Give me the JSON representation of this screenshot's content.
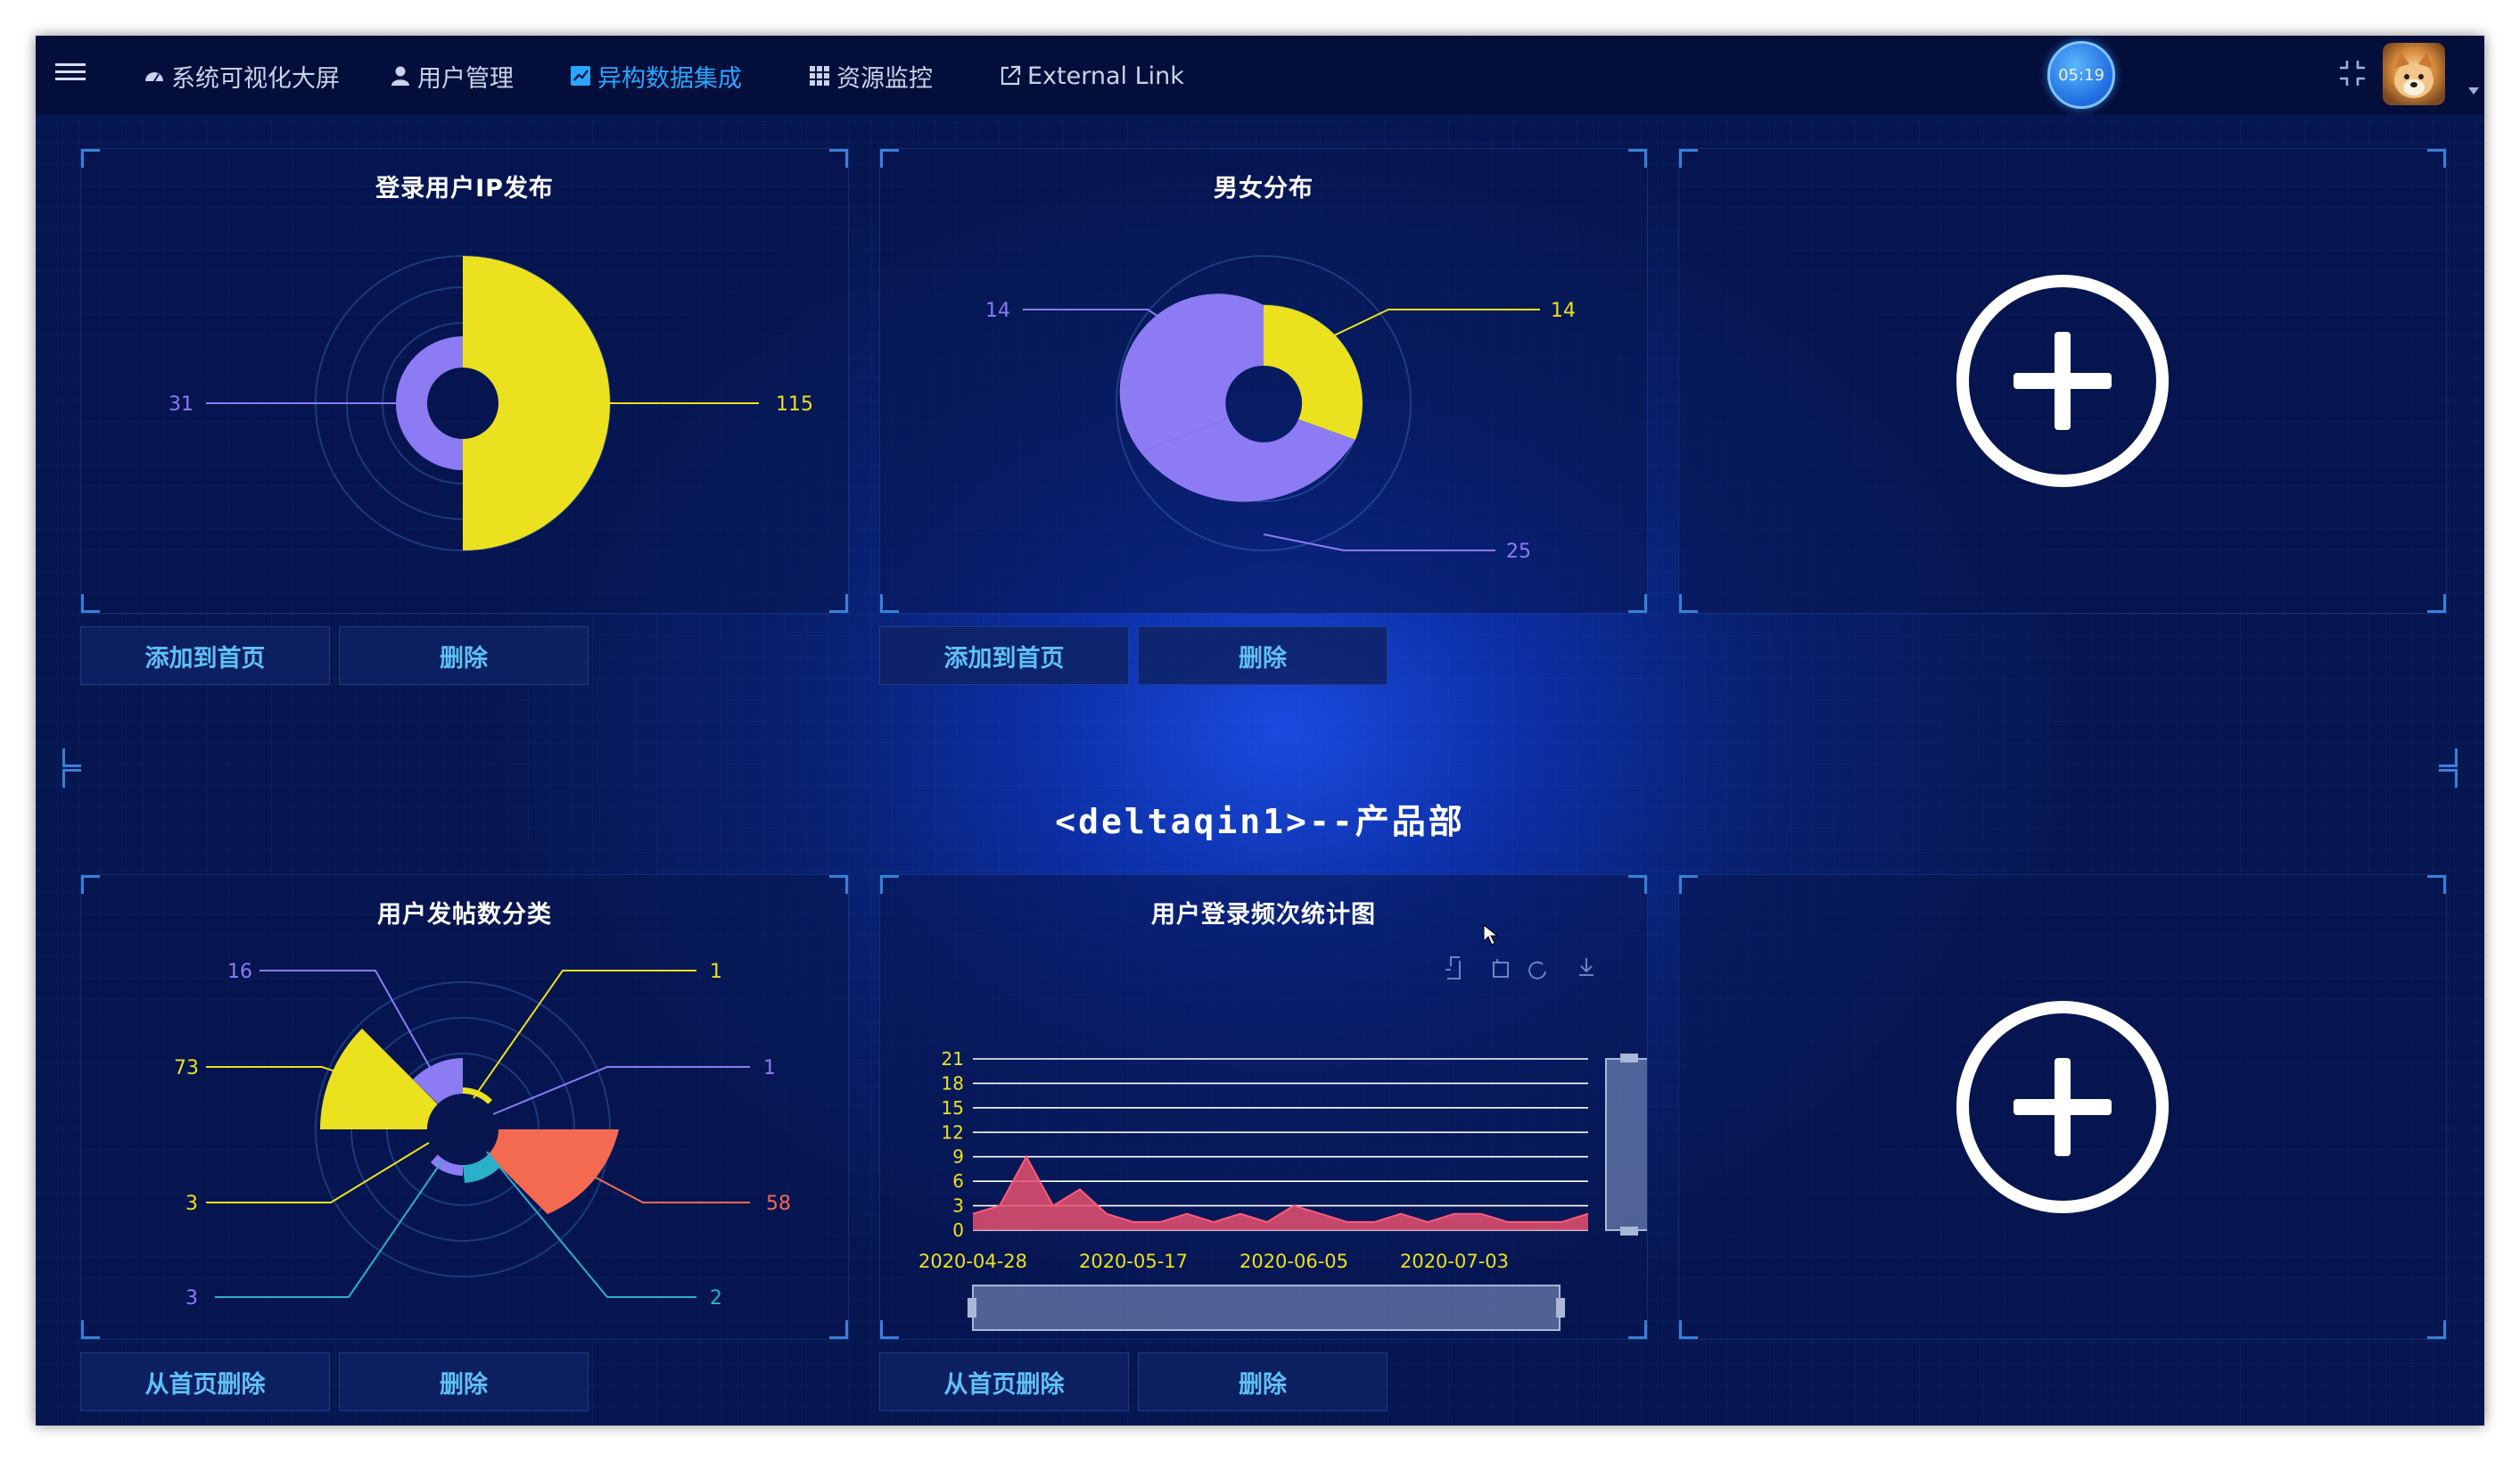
{
  "nav": {
    "items": [
      {
        "label": "系统可视化大屏",
        "icon": "dashboard-icon"
      },
      {
        "label": "用户管理",
        "icon": "user-icon"
      },
      {
        "label": "异构数据集成",
        "icon": "chart-icon",
        "active": true
      },
      {
        "label": "资源监控",
        "icon": "grid-icon"
      },
      {
        "label": "External Link",
        "icon": "external-link-icon"
      }
    ],
    "clock": "05:19"
  },
  "colors": {
    "accent": "#2aa6ff",
    "yellow": "#ece11f",
    "purple": "#8c7bf2",
    "coral": "#f46a50"
  },
  "section_title": "<deltaqin1>--产品部",
  "panels": [
    {
      "title": "登录用户IP发布",
      "buttons": [
        "添加到首页",
        "删除"
      ],
      "chart_data": {
        "type": "pie",
        "variant": "rose",
        "slices": [
          {
            "value": 115,
            "color": "#ece11f"
          },
          {
            "value": 31,
            "color": "#8c7bf2"
          }
        ],
        "labels": [
          "31",
          "115"
        ]
      }
    },
    {
      "title": "男女分布",
      "buttons": [
        "添加到首页",
        "删除"
      ],
      "chart_data": {
        "type": "pie",
        "variant": "rose",
        "slices": [
          {
            "value": 14,
            "color": "#ece11f"
          },
          {
            "value": 25,
            "color": "#8c7bf2"
          },
          {
            "value": 14,
            "color": "#8c7bf2"
          }
        ],
        "labels": [
          "14",
          "14",
          "25"
        ]
      }
    },
    {
      "title": "用户发帖数分类",
      "buttons": [
        "从首页删除",
        "删除"
      ],
      "chart_data": {
        "type": "pie",
        "variant": "rose",
        "slices": [
          {
            "value": 1,
            "color": "#ece11f"
          },
          {
            "value": 1,
            "color": "#8c7bf2"
          },
          {
            "value": 58,
            "color": "#f46a50"
          },
          {
            "value": 2,
            "color": "#2ab0c8"
          },
          {
            "value": 3,
            "color": "#8c7bf2"
          },
          {
            "value": 3,
            "color": "#ece11f"
          },
          {
            "value": 73,
            "color": "#ece11f"
          },
          {
            "value": 16,
            "color": "#8c7bf2"
          }
        ],
        "labels": [
          "1",
          "1",
          "58",
          "2",
          "3",
          "3",
          "73",
          "16"
        ]
      }
    },
    {
      "title": "用户登录频次统计图",
      "buttons": [
        "从首页删除",
        "删除"
      ],
      "toolbar_icons": [
        "zoom-select-icon",
        "zoom-reset-icon",
        "restore-icon",
        "download-icon"
      ],
      "chart_data": {
        "type": "area",
        "x_tick_labels": [
          "2020-04-28",
          "2020-05-17",
          "2020-06-05",
          "2020-07-03"
        ],
        "y_ticks": [
          "21",
          "18",
          "15",
          "12",
          "9",
          "6",
          "3",
          "0"
        ],
        "ylim": [
          0,
          21
        ],
        "values": [
          2,
          3,
          9,
          3,
          5,
          2,
          1,
          1,
          2,
          1,
          2,
          1,
          3,
          2,
          1,
          1,
          2,
          1,
          2,
          2,
          1,
          1,
          1,
          2
        ]
      }
    }
  ]
}
